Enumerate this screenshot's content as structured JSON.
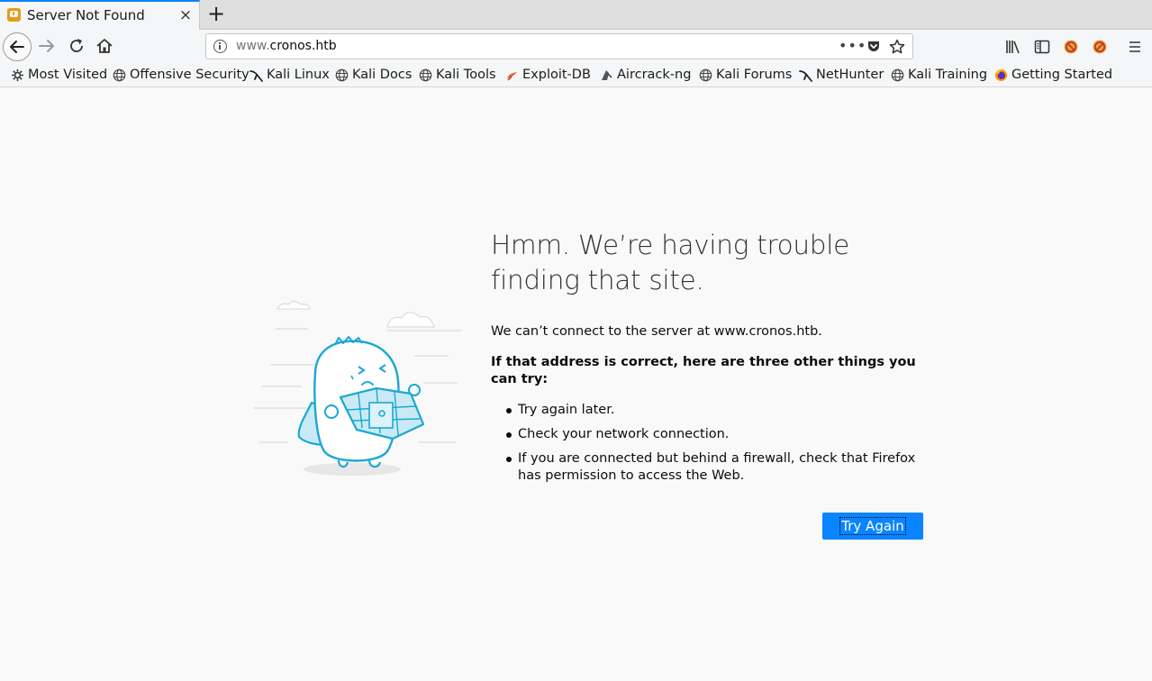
{
  "tab": {
    "title": "Server Not Found",
    "favicon": "warning-page-icon",
    "close_label": "×",
    "new_tab_label": "+"
  },
  "navbar": {
    "url_prefix": "www.",
    "url_host": "cronos.htb",
    "more_label": "•••"
  },
  "bookmarks": [
    {
      "label": "Most Visited",
      "icon": "gear-icon"
    },
    {
      "label": "Offensive Security",
      "icon": "globe-icon"
    },
    {
      "label": "Kali Linux",
      "icon": "kali-dragon-icon"
    },
    {
      "label": "Kali Docs",
      "icon": "globe-icon"
    },
    {
      "label": "Kali Tools",
      "icon": "globe-icon"
    },
    {
      "label": "Exploit-DB",
      "icon": "exploit-db-icon"
    },
    {
      "label": "Aircrack-ng",
      "icon": "aircrack-icon"
    },
    {
      "label": "Kali Forums",
      "icon": "globe-icon"
    },
    {
      "label": "NetHunter",
      "icon": "kali-dragon-icon"
    },
    {
      "label": "Kali Training",
      "icon": "globe-icon"
    },
    {
      "label": "Getting Started",
      "icon": "firefox-icon"
    }
  ],
  "error": {
    "title": "Hmm. We’re having trouble finding that site.",
    "description": "We can’t connect to the server at www.cronos.htb.",
    "suggestion_heading": "If that address is correct, here are three other things you can try:",
    "tips": [
      "Try again later.",
      "Check your network connection.",
      "If you are connected but behind a firewall, check that Firefox has permission to access the Web."
    ],
    "button_label": "Try Again"
  },
  "colors": {
    "accent": "#0a84ff",
    "illustration": "#1ba8d3",
    "page_bg": "#f9f9fa"
  }
}
